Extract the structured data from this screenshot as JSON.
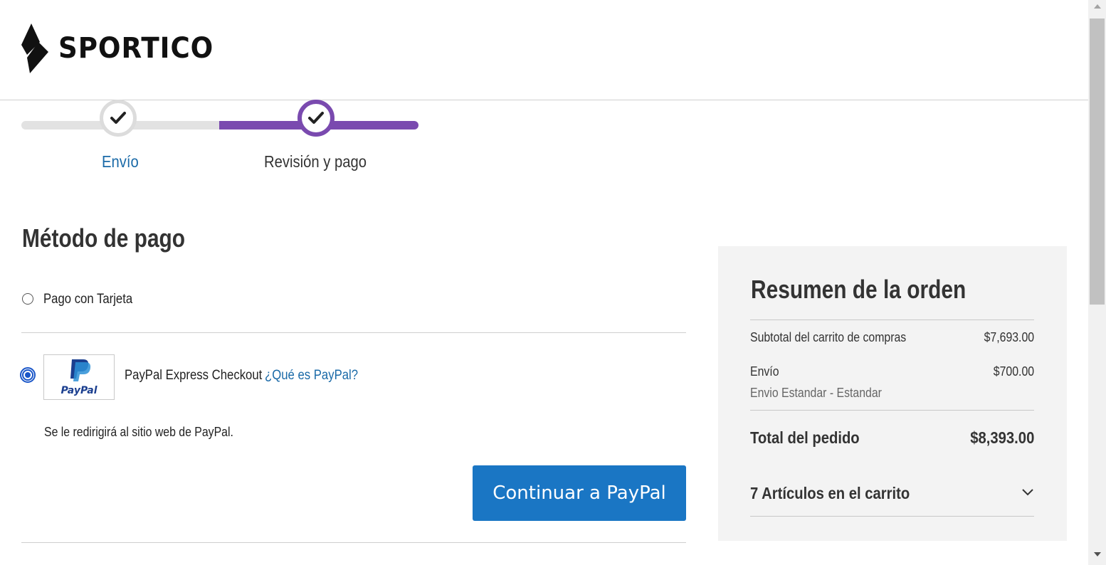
{
  "header": {
    "logo_text": "SPORTICO"
  },
  "progress": {
    "steps": [
      {
        "label": "Envío",
        "state": "completed"
      },
      {
        "label": "Revisión y pago",
        "state": "active"
      }
    ]
  },
  "payment": {
    "title": "Método de pago",
    "options": {
      "card": {
        "label": "Pago con Tarjeta",
        "selected": false
      },
      "paypal": {
        "label": "PayPal Express Checkout",
        "link_text": "¿Qué es PayPal?",
        "logo_text": "PayPal",
        "selected": true,
        "redirect_note": "Se le redirigirá al sitio web de PayPal."
      }
    },
    "continue_button": "Continuar a PayPal"
  },
  "summary": {
    "title": "Resumen de la orden",
    "subtotal_label": "Subtotal del carrito de compras",
    "subtotal_value": "$7,693.00",
    "shipping_label": "Envío",
    "shipping_value": "$700.00",
    "shipping_method": "Envio Estandar - Estandar",
    "total_label": "Total del pedido",
    "total_value": "$8,393.00",
    "items_label": "7 Artículos en el carrito"
  },
  "colors": {
    "accent_purple": "#7a4aaf",
    "link_blue": "#1a6aa8",
    "button_blue": "#1a76c4",
    "summary_bg": "#f3f3f3"
  },
  "icons": {
    "logo": "sportico-diamond-icon",
    "step_check": "check-icon",
    "items_toggle": "chevron-down-icon"
  }
}
